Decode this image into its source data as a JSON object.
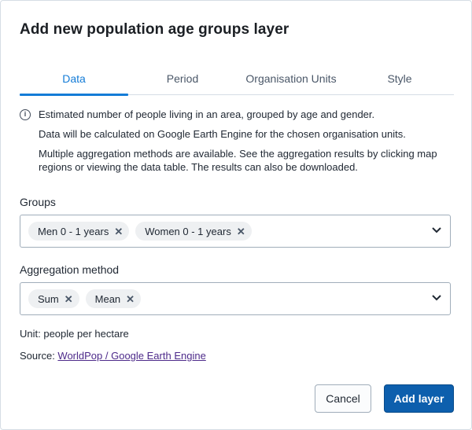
{
  "dialog": {
    "title": "Add new population age groups layer"
  },
  "tabs": [
    {
      "label": "Data",
      "active": true
    },
    {
      "label": "Period",
      "active": false
    },
    {
      "label": "Organisation Units",
      "active": false
    },
    {
      "label": "Style",
      "active": false
    }
  ],
  "info": {
    "icon": "info-icon",
    "line1": "Estimated number of people living in an area, grouped by age and gender.",
    "line2": "Data will be calculated on Google Earth Engine for the chosen organisation units.",
    "line3": "Multiple aggregation methods are available. See the aggregation results by clicking map regions or viewing the data table. The results can also be downloaded."
  },
  "groups": {
    "label": "Groups",
    "selected": [
      "Men 0 - 1 years",
      "Women 0 - 1 years"
    ]
  },
  "aggregation": {
    "label": "Aggregation method",
    "selected": [
      "Sum",
      "Mean"
    ]
  },
  "unit_text": "Unit: people per hectare",
  "source": {
    "prefix": "Source: ",
    "link_text": "WorldPop / Google Earth Engine"
  },
  "buttons": {
    "cancel": "Cancel",
    "add": "Add layer"
  },
  "colors": {
    "accent": "#147cd7",
    "primary_button": "#0d5fad",
    "link": "#4d2a8a"
  }
}
